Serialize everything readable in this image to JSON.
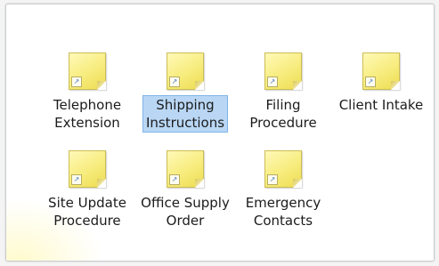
{
  "items": [
    {
      "label": "Telephone\nExtension",
      "icon": "note-shortcut-icon",
      "selected": false
    },
    {
      "label": "Shipping\nInstructions",
      "icon": "note-shortcut-icon",
      "selected": true
    },
    {
      "label": "Filing\nProcedure",
      "icon": "note-shortcut-icon",
      "selected": false
    },
    {
      "label": "Client Intake",
      "icon": "note-shortcut-icon",
      "selected": false
    },
    {
      "label": "Site Update\nProcedure",
      "icon": "note-shortcut-icon",
      "selected": false
    },
    {
      "label": "Office Supply\nOrder",
      "icon": "note-shortcut-icon",
      "selected": false
    },
    {
      "label": "Emergency\nContacts",
      "icon": "note-shortcut-icon",
      "selected": false
    }
  ],
  "colors": {
    "selection_fill": "#b9d7f4",
    "selection_border": "#7eb4ea",
    "note_yellow": "#f7ec7d"
  }
}
